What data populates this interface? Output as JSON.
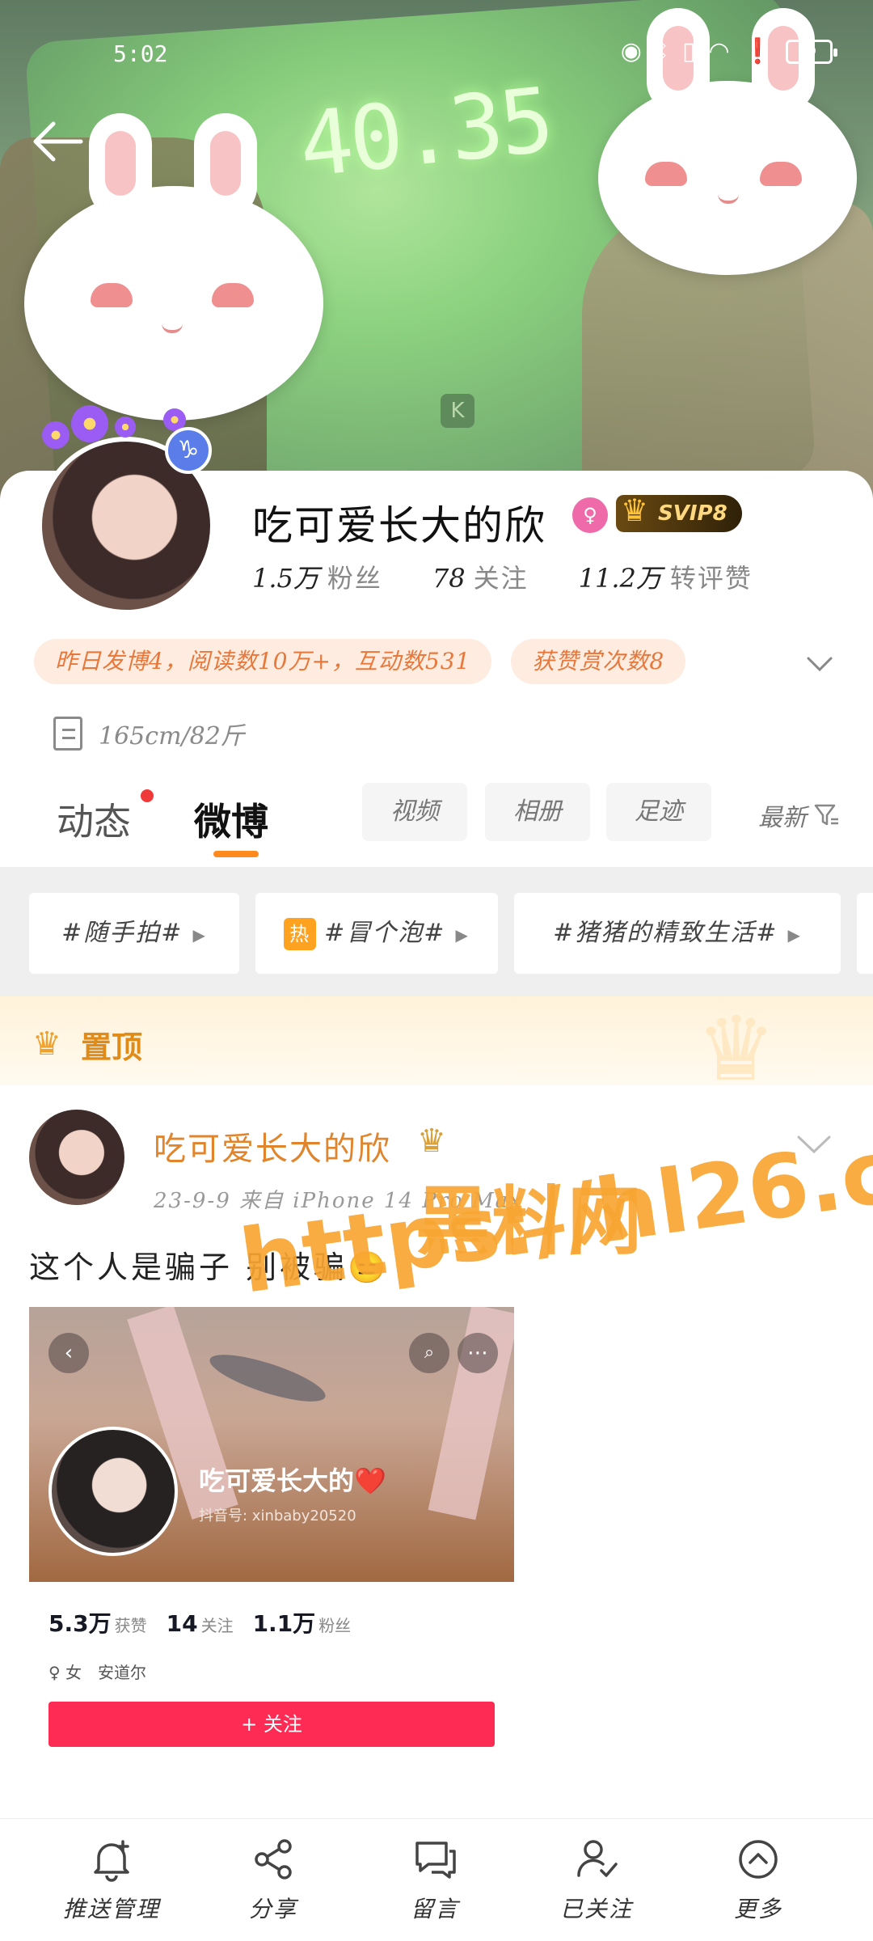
{
  "status_bar": {
    "time": "5:02",
    "battery": "69",
    "icons": [
      "eye-icon",
      "bluetooth-icon",
      "vibrate-icon",
      "wifi-icon",
      "alert-icon",
      "battery-icon"
    ]
  },
  "cover": {
    "scale_reading": "40.35",
    "scale_logo": "K"
  },
  "header": {
    "back_icon": "arrow-left-icon",
    "search_icon": "search-icon"
  },
  "profile": {
    "name": "吃可爱长大的欣",
    "zodiac": "♑",
    "svip_label": "SVIP8",
    "stats": [
      {
        "value": "1.5万",
        "label": "粉丝"
      },
      {
        "value": "78",
        "label": "关注"
      },
      {
        "value": "11.2万",
        "label": "转评赞"
      }
    ],
    "pills": [
      "昨日发博4，阅读数10万+，互动数531",
      "获赞赏次数8"
    ],
    "bio": "165cm/82斤"
  },
  "tabs": {
    "main": [
      "动态",
      "微博"
    ],
    "chips": [
      "视频",
      "相册",
      "足迹"
    ],
    "latest": "最新"
  },
  "topics": [
    {
      "label": "#随手拍#",
      "hot": false
    },
    {
      "label": "#冒个泡#",
      "hot": true,
      "hot_label": "热"
    },
    {
      "label": "#猪猪的精致生活#",
      "hot": false
    }
  ],
  "pinned": {
    "label": "置顶"
  },
  "post": {
    "author": "吃可爱长大的欣",
    "meta": "23-9-9  来自 iPhone 14 Pro Max",
    "text": "这个人是骗子 别被骗😑",
    "embed": {
      "name": "吃可爱长大的❤️",
      "id": "抖音号: xinbaby20520",
      "stats": [
        {
          "value": "5.3万",
          "label": "获赞"
        },
        {
          "value": "14",
          "label": "关注"
        },
        {
          "value": "1.1万",
          "label": "粉丝"
        }
      ],
      "tags": [
        "♀ 女",
        "安道尔"
      ],
      "follow": "+ 关注"
    }
  },
  "watermark": {
    "line1": "黑料网",
    "line2": "https://hl26.co"
  },
  "bottom_bar": [
    {
      "label": "推送管理",
      "icon": "bell-plus-icon"
    },
    {
      "label": "分享",
      "icon": "share-icon"
    },
    {
      "label": "留言",
      "icon": "comment-icon"
    },
    {
      "label": "已关注",
      "icon": "user-check-icon"
    },
    {
      "label": "更多",
      "icon": "chevron-up-circle-icon"
    }
  ],
  "colors": {
    "accent": "#ff8a1c",
    "pill_text": "#e8773a",
    "follow_red": "#fe2c55",
    "watermark": "#f7a532"
  }
}
